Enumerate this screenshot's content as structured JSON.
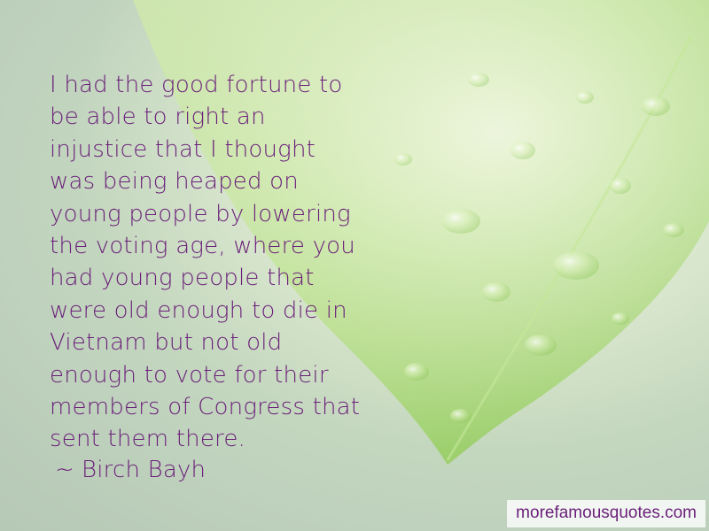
{
  "quote": {
    "lines": [
      "I had the good fortune to",
      "be able to right an",
      "injustice that I thought",
      "was being heaped on",
      "young people by lowering",
      "the voting age, where you",
      "had young people that",
      "were old enough to die in",
      "Vietnam but not old",
      "enough to vote for their",
      "members of Congress that",
      "sent them there."
    ],
    "text_color": "#6a1f79"
  },
  "author": {
    "prefix": "~",
    "name": "Birch Bayh"
  },
  "watermark": {
    "text": "morefamousquotes.com"
  },
  "background": {
    "subject": "green leaf with water droplets",
    "leaf_color": "#9fd36a",
    "backdrop_color": "#c4d7bd"
  }
}
